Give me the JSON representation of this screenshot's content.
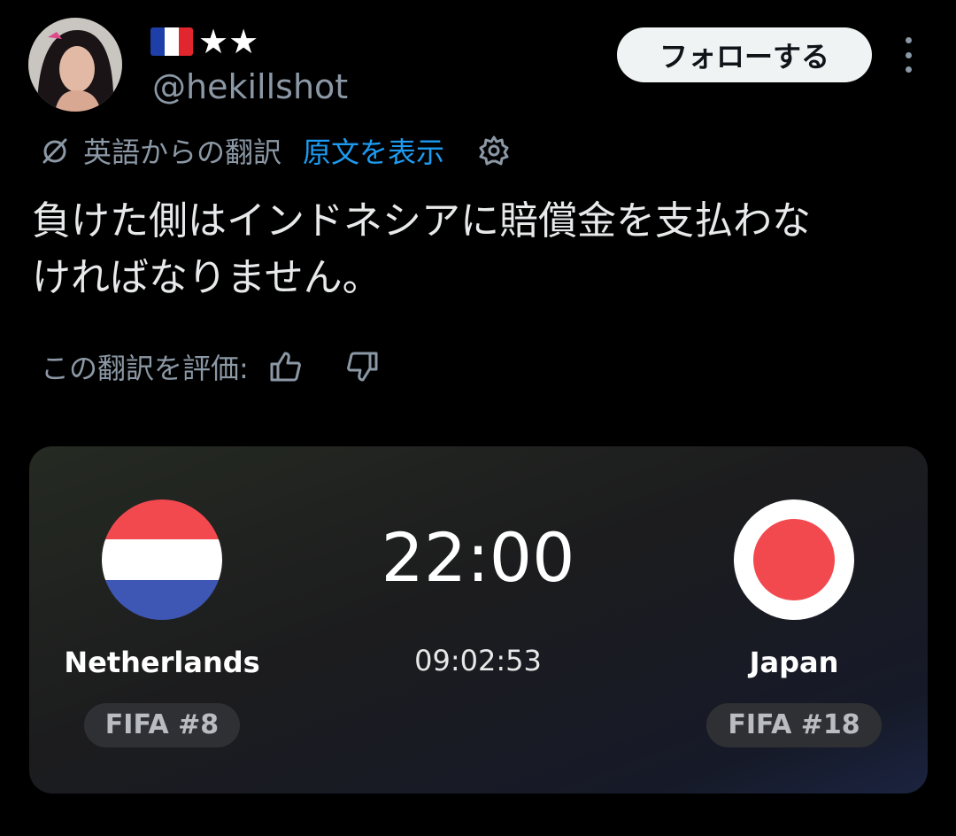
{
  "user": {
    "display_name_stars": "★★",
    "handle": "@hekillshot",
    "flag_colors": [
      "#1f3fa8",
      "#ffffff",
      "#e1262d"
    ]
  },
  "header": {
    "follow_label": "フォローする",
    "more_icon": "more-vertical-icon"
  },
  "translation": {
    "icon": "translate-icon",
    "label": "英語からの翻訳",
    "show_original": "原文を表示",
    "settings_icon": "gear-icon"
  },
  "post": {
    "text": "負けた側はインドネシアに賠償金を支払わな\nければなりません。"
  },
  "rating": {
    "label": "この翻訳を評価:",
    "up_icon": "thumbs-up-icon",
    "down_icon": "thumbs-down-icon"
  },
  "match": {
    "home": {
      "name": "Netherlands",
      "rank": "FIFA #8",
      "flag_colors": [
        "#f2494f",
        "#ffffff",
        "#3f57b4"
      ]
    },
    "away": {
      "name": "Japan",
      "rank": "FIFA #18",
      "flag_colors": [
        "#ffffff",
        "#f2494f"
      ]
    },
    "kickoff_time": "22:00",
    "countdown": "09:02:53"
  },
  "colors": {
    "accent_link": "#1d9bf0",
    "secondary_text": "#8b98a5"
  }
}
